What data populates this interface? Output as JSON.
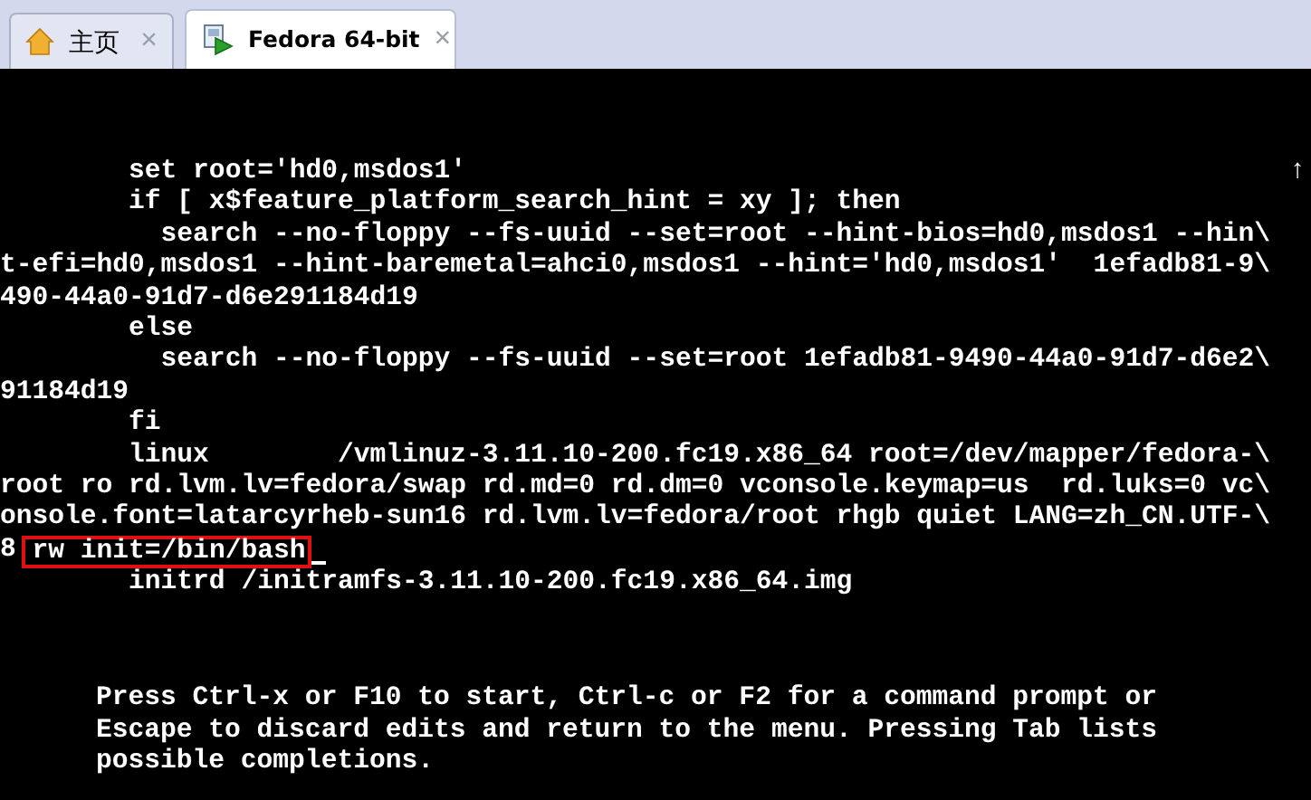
{
  "tabs": [
    {
      "label": "主页",
      "kind": "home",
      "selected": false,
      "close": "×"
    },
    {
      "label": "Fedora 64-bit",
      "kind": "vm",
      "selected": true,
      "close": "×"
    }
  ],
  "console": {
    "scroll_marker": "↑",
    "lines": [
      {
        "kind": "plain",
        "text": "        set root='hd0,msdos1'"
      },
      {
        "kind": "plain",
        "text": "        if [ x$feature_platform_search_hint = xy ]; then"
      },
      {
        "kind": "plain",
        "text": "          search --no-floppy --fs-uuid --set=root --hint-bios=hd0,msdos1 --hin\\"
      },
      {
        "kind": "plain",
        "text": "t-efi=hd0,msdos1 --hint-baremetal=ahci0,msdos1 --hint='hd0,msdos1'  1efadb81-9\\"
      },
      {
        "kind": "plain",
        "text": "490-44a0-91d7-d6e291184d19"
      },
      {
        "kind": "plain",
        "text": "        else"
      },
      {
        "kind": "plain",
        "text": "          search --no-floppy --fs-uuid --set=root 1efadb81-9490-44a0-91d7-d6e2\\"
      },
      {
        "kind": "plain",
        "text": "91184d19"
      },
      {
        "kind": "plain",
        "text": "        fi"
      },
      {
        "kind": "plain",
        "text": "        linux        /vmlinuz-3.11.10-200.fc19.x86_64 root=/dev/mapper/fedora-\\"
      },
      {
        "kind": "plain",
        "text": "root ro rd.lvm.lv=fedora/swap rd.md=0 rd.dm=0 vconsole.keymap=us  rd.luks=0 vc\\"
      },
      {
        "kind": "plain",
        "text": "onsole.font=latarcyrheb-sun16 rd.lvm.lv=fedora/root rhgb quiet LANG=zh_CN.UTF-\\"
      },
      {
        "kind": "highlighted",
        "text": "8 ",
        "highlight": "rw init=/bin/bash",
        "cursor": true
      },
      {
        "kind": "plain",
        "text": "        initrd /initramfs-3.11.10-200.fc19.x86_64.img"
      }
    ],
    "help": [
      "Press Ctrl-x or F10 to start, Ctrl-c or F2 for a command prompt or",
      "Escape to discard edits and return to the menu. Pressing Tab lists",
      "possible completions."
    ]
  }
}
